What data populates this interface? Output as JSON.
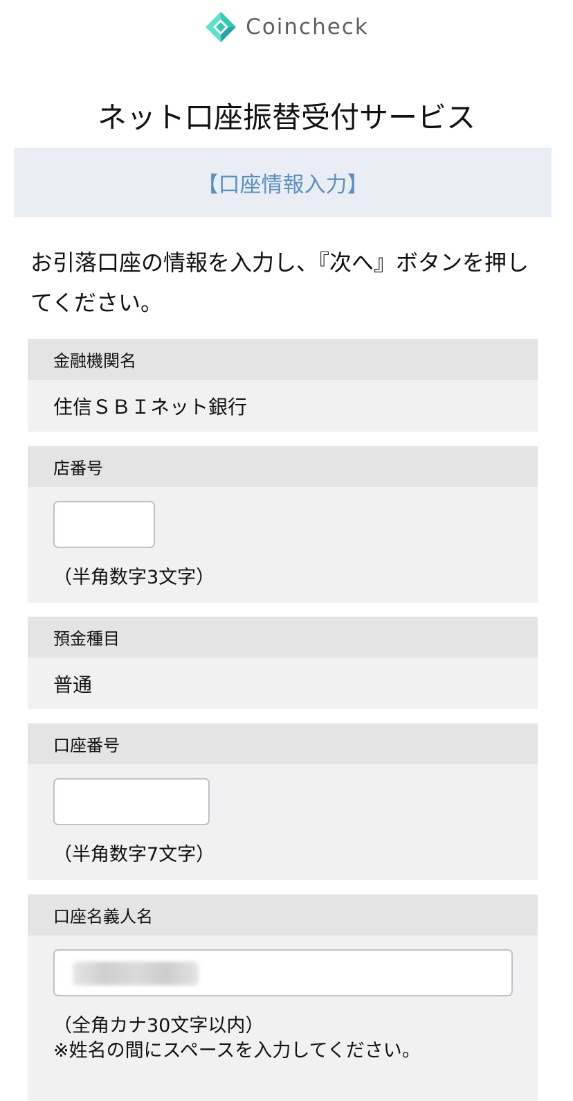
{
  "brand": {
    "name": "Coincheck",
    "logo_colors": [
      "#5fe0c8",
      "#34c7b2",
      "#2aa3a8"
    ],
    "logo_icon": "diamond-logo-icon"
  },
  "page": {
    "title": "ネット口座振替受付サービス",
    "step": "【口座情報入力】",
    "instruction": "お引落口座の情報を入力し、『次へ』ボタンを押してください。"
  },
  "form": {
    "bank": {
      "label": "金融機関名",
      "value": "住信ＳＢＩネット銀行"
    },
    "branch_number": {
      "label": "店番号",
      "value": "",
      "hint": "（半角数字3文字）"
    },
    "account_type": {
      "label": "預金種目",
      "value": "普通"
    },
    "account_number": {
      "label": "口座番号",
      "value": "",
      "hint": "（半角数字7文字）"
    },
    "account_holder": {
      "label": "口座名義人名",
      "value": "",
      "hint_1": "（全角カナ30文字以内）",
      "hint_2": "※姓名の間にスペースを入力してください。"
    }
  },
  "colors": {
    "accent": "#5c8ebf",
    "banner_bg": "#e9eef5",
    "field_head_bg": "#e4e4e4",
    "field_body_bg": "#f1f1f1",
    "input_border": "#b9c3cc"
  }
}
